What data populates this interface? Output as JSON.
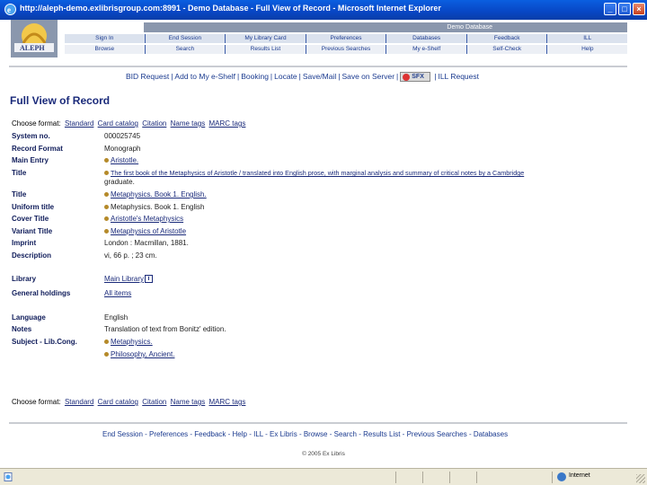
{
  "window": {
    "title": "http://aleph-demo.exlibrisgroup.com:8991 - Demo Database - Full View of Record - Microsoft Internet Explorer",
    "minimize": "_",
    "maximize": "□",
    "close": "×"
  },
  "header": {
    "logo_text": "ALEPH",
    "database_name": "Demo Database",
    "nav_top": [
      "Sign In",
      "End Session",
      "My Library Card",
      "Preferences",
      "Databases",
      "Feedback",
      "ILL"
    ],
    "nav_bottom": [
      "Browse",
      "Search",
      "Results List",
      "Previous Searches",
      "My e-Shelf",
      "Self-Check",
      "Help"
    ]
  },
  "action_bar": {
    "items": [
      "BID Request",
      "Add to My e-Shelf",
      "Booking",
      "Locate",
      "Save/Mail",
      "Save on Server"
    ],
    "sfx_label": "SFX",
    "ill": "ILL Request"
  },
  "page_title": "Full View of Record",
  "format_choice": {
    "label": "Choose format:",
    "options": [
      "Standard",
      "Card catalog",
      "Citation",
      "Name tags",
      "MARC tags"
    ]
  },
  "record": {
    "system_no": {
      "label": "System no.",
      "value": "000025745"
    },
    "record_format": {
      "label": "Record Format",
      "value": "Monograph"
    },
    "main_entry": {
      "label": "Main Entry",
      "value": "Aristotle."
    },
    "title": {
      "label": "Title",
      "value": "The first book of the Metaphysics of Aristotle / translated into English prose, with marginal analysis and summary of critical notes by a Cambridge",
      "value2": "graduate."
    },
    "title2": {
      "label": "Title",
      "value": "Metaphysics. Book 1. English."
    },
    "uniform_title": {
      "label": "Uniform title",
      "value": "Metaphysics. Book 1. English"
    },
    "cover_title": {
      "label": "Cover Title",
      "value": "Aristotle's Metaphysics"
    },
    "variant_title": {
      "label": "Variant Title",
      "value": "Metaphysics of Aristotle"
    },
    "imprint": {
      "label": "Imprint",
      "value": "London : Macmillan, 1881."
    },
    "description": {
      "label": "Description",
      "value": "vi, 66 p. ; 23 cm."
    },
    "library": {
      "label": "Library",
      "value": "Main Library",
      "info": "i"
    },
    "general_holdings": {
      "label": "General holdings",
      "value": "All items"
    },
    "language": {
      "label": "Language",
      "value": "English"
    },
    "notes": {
      "label": "Notes",
      "value": "Translation of text from Bonitz' edition."
    },
    "subject": {
      "label": "Subject - Lib.Cong.",
      "value": "Metaphysics.",
      "value2": "Philosophy, Ancient."
    }
  },
  "footer": {
    "links": [
      "End Session",
      "Preferences",
      "Feedback",
      "Help",
      "ILL",
      "Ex Libris",
      "Browse",
      "Search",
      "Results List",
      "Previous Searches",
      "Databases"
    ],
    "copyright": "© 2005 Ex Libris"
  },
  "statusbar": {
    "zone": "Internet"
  },
  "colors": {
    "titlebar": "#0846c4",
    "heading": "#1a2a7a",
    "label": "#0f1c5a",
    "nav_bar": "#dbe2ee"
  }
}
